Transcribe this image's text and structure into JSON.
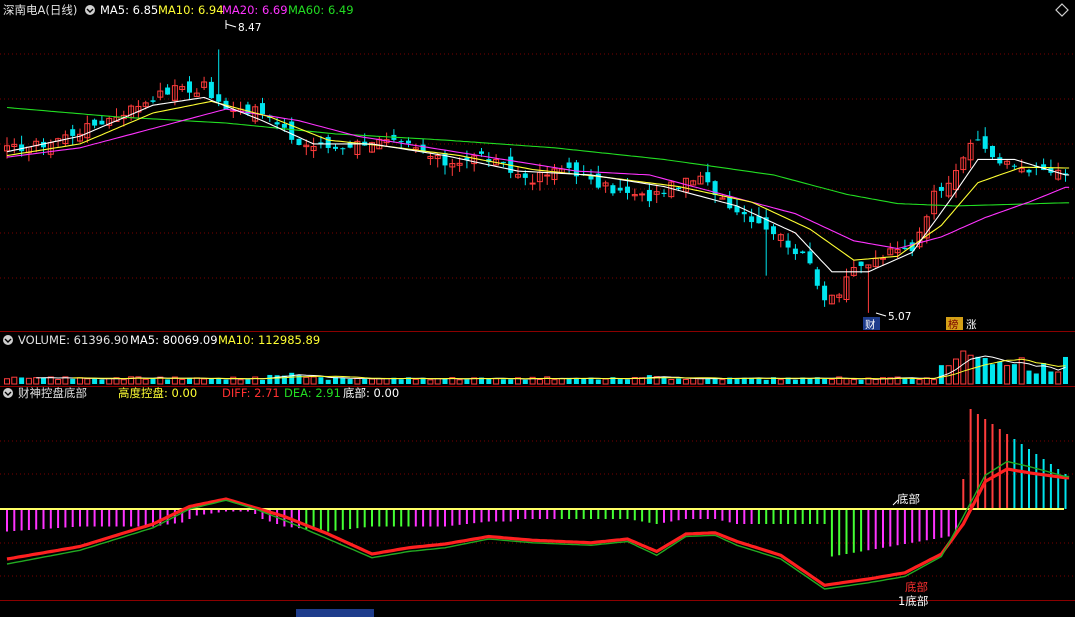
{
  "colors": {
    "background": "#000000",
    "up": "#ff3c3c",
    "down": "#00e5ee",
    "ma5": "#ffffff",
    "ma10": "#ffff33",
    "ma20": "#ff33ff",
    "ma60": "#22dd22",
    "divider": "#8b0000",
    "grid": "#7a0000",
    "baseline": "#ffff66",
    "dea_line": "#ff2020",
    "diff_line": "#22aa22"
  },
  "main_panel": {
    "stock_name": "深南电A(日线)",
    "ma5_text": "MA5: 6.85",
    "ma10_text": "MA10: 6.94",
    "ma20_text": "MA20: 6.69",
    "ma60_text": "MA60: 6.49",
    "high_label": "8.47",
    "low_label": "5.07",
    "marker_cai": "财",
    "marker_bang": "榜",
    "marker_zhang": "涨"
  },
  "volume_panel": {
    "volume_text": "VOLUME: 61396.90",
    "ma5_text": "MA5: 80069.09",
    "ma10_text": "MA10: 112985.89"
  },
  "indicator_panel": {
    "name": "财神控盘底部",
    "gaodu_text": "高度控盘: 0.00",
    "diff_text": "DIFF: 2.71",
    "dea_text": "DEA: 2.91",
    "dibu_text": "底部: 0.00",
    "bottom_label_1": "底部",
    "bottom_label_2": "底部",
    "bottom_label_3": "1底部"
  },
  "chart_data": [
    {
      "type": "candlestick",
      "title": "深南电A(日线)",
      "series": [
        {
          "name": "MA5",
          "value": 6.85
        },
        {
          "name": "MA10",
          "value": 6.94
        },
        {
          "name": "MA20",
          "value": 6.69
        },
        {
          "name": "MA60",
          "value": 6.49
        }
      ],
      "annotations": [
        {
          "text": "8.47",
          "value": 8.47,
          "kind": "high"
        },
        {
          "text": "5.07",
          "value": 5.07,
          "kind": "low"
        }
      ],
      "ylim": [
        4.9,
        8.85
      ],
      "close_path": [
        [
          0,
          7.18
        ],
        [
          5,
          7.25
        ],
        [
          10,
          7.42
        ],
        [
          15,
          7.62
        ],
        [
          20,
          7.85
        ],
        [
          24,
          8.0
        ],
        [
          27,
          7.85
        ],
        [
          30,
          7.75
        ],
        [
          35,
          7.65
        ],
        [
          40,
          7.25
        ],
        [
          45,
          7.2
        ],
        [
          50,
          7.3
        ],
        [
          55,
          7.22
        ],
        [
          60,
          7.0
        ],
        [
          65,
          7.1
        ],
        [
          70,
          6.85
        ],
        [
          72,
          6.8
        ],
        [
          77,
          6.95
        ],
        [
          80,
          6.75
        ],
        [
          85,
          6.6
        ],
        [
          88,
          6.55
        ],
        [
          91,
          6.7
        ],
        [
          95,
          6.8
        ],
        [
          100,
          6.4
        ],
        [
          103,
          6.25
        ],
        [
          106,
          6.05
        ],
        [
          110,
          5.7
        ],
        [
          112,
          5.25
        ],
        [
          115,
          5.55
        ],
        [
          118,
          5.7
        ],
        [
          121,
          5.85
        ],
        [
          124,
          5.9
        ],
        [
          127,
          6.6
        ],
        [
          129,
          6.8
        ],
        [
          131,
          7.1
        ],
        [
          133,
          7.3
        ],
        [
          136,
          7.0
        ],
        [
          139,
          6.95
        ],
        [
          142,
          6.9
        ],
        [
          145,
          6.85
        ]
      ],
      "ma5_path": [
        [
          0,
          7.15
        ],
        [
          10,
          7.35
        ],
        [
          20,
          7.75
        ],
        [
          27,
          7.85
        ],
        [
          35,
          7.55
        ],
        [
          42,
          7.25
        ],
        [
          50,
          7.25
        ],
        [
          60,
          7.1
        ],
        [
          70,
          6.9
        ],
        [
          80,
          6.85
        ],
        [
          90,
          6.7
        ],
        [
          100,
          6.45
        ],
        [
          108,
          6.1
        ],
        [
          113,
          5.6
        ],
        [
          118,
          5.6
        ],
        [
          124,
          5.85
        ],
        [
          129,
          6.5
        ],
        [
          133,
          7.05
        ],
        [
          138,
          7.05
        ],
        [
          145,
          6.85
        ]
      ],
      "ma10_path": [
        [
          0,
          7.1
        ],
        [
          10,
          7.25
        ],
        [
          20,
          7.65
        ],
        [
          28,
          7.8
        ],
        [
          36,
          7.6
        ],
        [
          44,
          7.3
        ],
        [
          52,
          7.22
        ],
        [
          62,
          7.1
        ],
        [
          72,
          6.92
        ],
        [
          82,
          6.82
        ],
        [
          92,
          6.7
        ],
        [
          102,
          6.5
        ],
        [
          110,
          6.15
        ],
        [
          116,
          5.75
        ],
        [
          122,
          5.8
        ],
        [
          128,
          6.2
        ],
        [
          133,
          6.75
        ],
        [
          139,
          6.95
        ],
        [
          145,
          6.94
        ]
      ],
      "ma20_path": [
        [
          0,
          7.08
        ],
        [
          10,
          7.2
        ],
        [
          20,
          7.45
        ],
        [
          30,
          7.7
        ],
        [
          40,
          7.55
        ],
        [
          48,
          7.35
        ],
        [
          58,
          7.2
        ],
        [
          68,
          7.05
        ],
        [
          78,
          6.9
        ],
        [
          88,
          6.85
        ],
        [
          98,
          6.6
        ],
        [
          108,
          6.35
        ],
        [
          116,
          6.0
        ],
        [
          122,
          5.9
        ],
        [
          128,
          6.05
        ],
        [
          134,
          6.3
        ],
        [
          140,
          6.5
        ],
        [
          145,
          6.69
        ]
      ],
      "ma60_path": [
        [
          0,
          7.72
        ],
        [
          15,
          7.6
        ],
        [
          30,
          7.52
        ],
        [
          45,
          7.38
        ],
        [
          60,
          7.3
        ],
        [
          75,
          7.2
        ],
        [
          90,
          7.05
        ],
        [
          105,
          6.85
        ],
        [
          115,
          6.6
        ],
        [
          122,
          6.48
        ],
        [
          130,
          6.45
        ],
        [
          145,
          6.49
        ]
      ]
    },
    {
      "type": "bar",
      "title": "VOLUME",
      "series": [
        {
          "name": "VOLUME",
          "value": 61396.9
        },
        {
          "name": "MA5",
          "value": 80069.09
        },
        {
          "name": "MA10",
          "value": 112985.89
        }
      ],
      "ylim": [
        0,
        330000
      ]
    },
    {
      "type": "bar",
      "title": "财神控盘底部",
      "series": [
        {
          "name": "高度控盘",
          "value": 0.0
        },
        {
          "name": "DIFF",
          "value": 2.71
        },
        {
          "name": "DEA",
          "value": 2.91
        },
        {
          "name": "底部",
          "value": 0.0
        }
      ],
      "ylim": [
        -4.2,
        4.2
      ],
      "dea_path": [
        [
          0,
          -2.0
        ],
        [
          10,
          -1.5
        ],
        [
          20,
          -0.6
        ],
        [
          25,
          0.1
        ],
        [
          30,
          0.4
        ],
        [
          34,
          0.05
        ],
        [
          38,
          -0.3
        ],
        [
          44,
          -1.0
        ],
        [
          50,
          -1.8
        ],
        [
          55,
          -1.55
        ],
        [
          60,
          -1.4
        ],
        [
          66,
          -1.1
        ],
        [
          72,
          -1.25
        ],
        [
          80,
          -1.35
        ],
        [
          85,
          -1.2
        ],
        [
          89,
          -1.7
        ],
        [
          93,
          -1.0
        ],
        [
          97,
          -0.95
        ],
        [
          100,
          -1.3
        ],
        [
          106,
          -1.85
        ],
        [
          112,
          -3.05
        ],
        [
          118,
          -2.8
        ],
        [
          123,
          -2.55
        ],
        [
          128,
          -1.8
        ],
        [
          131,
          -0.6
        ],
        [
          134,
          1.1
        ],
        [
          137,
          1.6
        ],
        [
          140,
          1.45
        ],
        [
          145,
          1.25
        ]
      ],
      "diff_path": [
        [
          0,
          -2.2
        ],
        [
          10,
          -1.65
        ],
        [
          20,
          -0.75
        ],
        [
          25,
          0.0
        ],
        [
          30,
          0.35
        ],
        [
          34,
          0.0
        ],
        [
          38,
          -0.45
        ],
        [
          44,
          -1.2
        ],
        [
          50,
          -1.95
        ],
        [
          55,
          -1.7
        ],
        [
          60,
          -1.55
        ],
        [
          66,
          -1.2
        ],
        [
          72,
          -1.35
        ],
        [
          80,
          -1.45
        ],
        [
          85,
          -1.3
        ],
        [
          89,
          -1.85
        ],
        [
          93,
          -1.1
        ],
        [
          97,
          -1.05
        ],
        [
          100,
          -1.45
        ],
        [
          106,
          -2.0
        ],
        [
          112,
          -3.2
        ],
        [
          118,
          -2.95
        ],
        [
          123,
          -2.7
        ],
        [
          128,
          -1.9
        ],
        [
          131,
          -0.3
        ],
        [
          134,
          1.35
        ],
        [
          137,
          1.9
        ],
        [
          140,
          1.7
        ],
        [
          145,
          1.3
        ]
      ]
    }
  ]
}
